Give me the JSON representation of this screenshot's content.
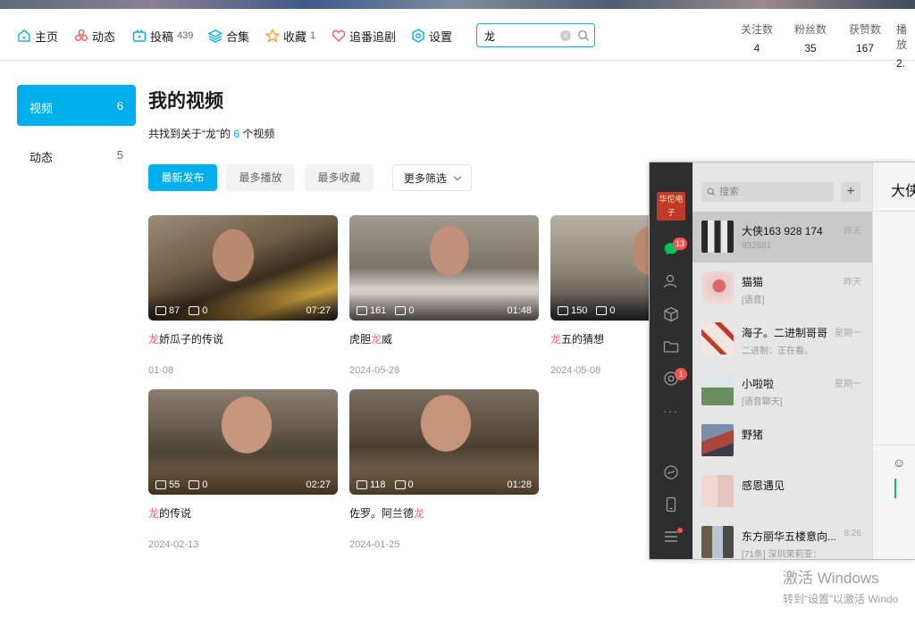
{
  "nav": {
    "home": "主页",
    "dynamic": "动态",
    "posts": "投稿",
    "posts_count": "439",
    "collection": "合集",
    "favorites": "收藏",
    "favorites_count": "1",
    "bangumi": "追番追剧",
    "settings": "设置"
  },
  "search": {
    "value": "龙"
  },
  "stats": [
    {
      "label": "关注数",
      "value": "4"
    },
    {
      "label": "粉丝数",
      "value": "35"
    },
    {
      "label": "获赞数",
      "value": "167"
    },
    {
      "label": "播放",
      "value": "2."
    }
  ],
  "sidebar": {
    "video_label": "视频",
    "video_count": "6",
    "dynamic_label": "动态",
    "dynamic_count": "5"
  },
  "main": {
    "title": "我的视频",
    "found_prefix": "共找到关于“龙”的",
    "found_count": "6",
    "found_suffix": "个视频"
  },
  "filters": {
    "latest": "最新发布",
    "most_played": "最多播放",
    "most_fav": "最多收藏",
    "more": "更多筛选"
  },
  "videos": [
    {
      "plays": "87",
      "danmaku": "0",
      "duration": "07:27",
      "title_hl": "龙",
      "title_rest": "娇瓜子的传说",
      "title_pre": "",
      "title_post": "",
      "date": "01-08"
    },
    {
      "plays": "161",
      "danmaku": "0",
      "duration": "01:48",
      "title_pre": "虎胆",
      "title_hl": "龙",
      "title_post": "威",
      "title_rest": "",
      "date": "2024-05-28"
    },
    {
      "plays": "150",
      "danmaku": "0",
      "duration": "",
      "title_hl": "龙",
      "title_rest": "五的猜想",
      "title_pre": "",
      "title_post": "",
      "date": "2024-05-08"
    },
    {
      "plays": "55",
      "danmaku": "0",
      "duration": "02:27",
      "title_hl": "龙",
      "title_rest": "的传说",
      "title_pre": "",
      "title_post": "",
      "date": "2024-02-13"
    },
    {
      "plays": "118",
      "danmaku": "0",
      "duration": "01:28",
      "title_pre": "佐罗。阿兰德",
      "title_hl": "龙",
      "title_post": "",
      "title_rest": "",
      "date": "2024-01-25"
    }
  ],
  "chat": {
    "search_placeholder": "搜索",
    "plus": "+",
    "chat_badge": "13",
    "moments_badge": "1",
    "more_dots": "···",
    "header_name": "大侠",
    "conversations": [
      {
        "name": "大侠163 928 174",
        "time": "昨天",
        "preview": "932581"
      },
      {
        "name": "猫猫",
        "time": "昨天",
        "preview": "[语音]"
      },
      {
        "name": "海子。二进制哥哥",
        "time": "星期一",
        "preview": "二进制：正在看。"
      },
      {
        "name": "小啦啦",
        "time": "星期一",
        "preview": "[语音聊天]"
      },
      {
        "name": "野猪",
        "time": "",
        "preview": ""
      },
      {
        "name": "感恩遇见",
        "time": "",
        "preview": ""
      },
      {
        "name": "东方丽华五楼意向...",
        "time": "8:26",
        "preview": "[71条] 深圳茉莉亚："
      }
    ],
    "avatar_text": "华佗电子"
  },
  "watermark": {
    "line1": "激活 Windows",
    "line2": "转到“设置”以激活 Windo"
  }
}
